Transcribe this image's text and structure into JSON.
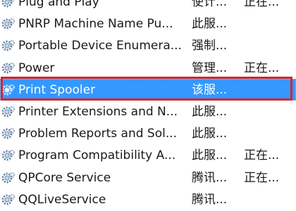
{
  "colors": {
    "selection_background": "#3399ff",
    "selection_text": "#ffffff",
    "highlight_outline": "#d9232b",
    "gear_icon": "#6f8aa8"
  },
  "icon": "services-gear-icon",
  "services": [
    {
      "name": "Plug and Play",
      "description": "使计...",
      "status": "正在..."
    },
    {
      "name": "PNRP Machine Name Pu...",
      "description": "此服...",
      "status": ""
    },
    {
      "name": "Portable Device Enumera...",
      "description": "强制...",
      "status": ""
    },
    {
      "name": "Power",
      "description": "管理...",
      "status": "正在..."
    },
    {
      "name": "Print Spooler",
      "description": "该服...",
      "status": ""
    },
    {
      "name": "Printer Extensions and N...",
      "description": "此服...",
      "status": ""
    },
    {
      "name": "Problem Reports and Sol...",
      "description": "此服...",
      "status": ""
    },
    {
      "name": "Program Compatibility A...",
      "description": "此服...",
      "status": "正在..."
    },
    {
      "name": "QPCore Service",
      "description": "腾讯...",
      "status": "正在..."
    },
    {
      "name": "QQLiveService",
      "description": "腾讯...",
      "status": ""
    }
  ],
  "selected_service_index": 4
}
